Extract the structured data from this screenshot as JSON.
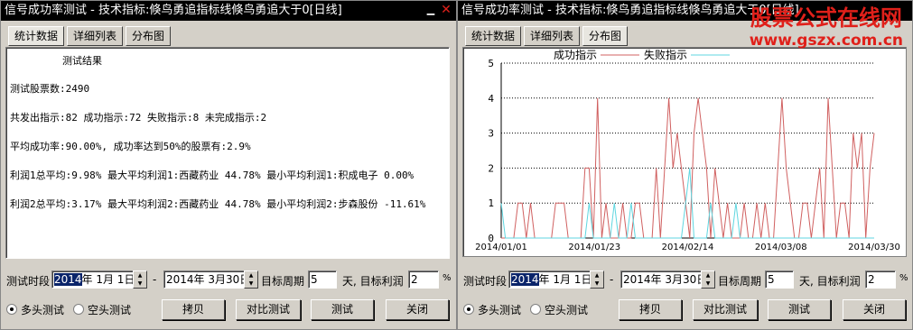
{
  "left": {
    "title": "信号成功率测试 - 技术指标:倏鸟勇追指标线倏鸟勇追大于0[日线]",
    "tabs": [
      "统计数据",
      "详细列表",
      "分布图"
    ],
    "active_tab": 0,
    "report": {
      "heading": "测试结果",
      "lines": [
        "测试股票数:2490",
        "共发出指示:82 成功指示:72 失败指示:8 未完成指示:2",
        "平均成功率:90.00%, 成功率达到50%的股票有:2.9%",
        "利润1总平均:9.98% 最大平均利润1:西藏药业 44.78% 最小平均利润1:积成电子 0.00%",
        "利润2总平均:3.17% 最大平均利润2:西藏药业 44.78% 最小平均利润2:步森股份 -11.61%"
      ]
    },
    "controls": {
      "period_label": "测试时段",
      "start_year": "2014",
      "start_rest": "年  1月 1日",
      "dash": "-",
      "end_date": "2014年  3月30日",
      "target_period_label": "目标周期",
      "target_period": "5",
      "target_profit_label": "天, 目标利润",
      "target_profit": "2",
      "percent": "%"
    },
    "radios": {
      "long": "多头测试",
      "short": "空头测试"
    },
    "buttons": {
      "copy": "拷贝",
      "compare": "对比测试",
      "test": "测试",
      "close": "关闭"
    }
  },
  "right": {
    "title": "信号成功率测试 - 技术指标:倏鸟勇追指标线倏鸟勇追大于0[日线]",
    "tabs": [
      "统计数据",
      "详细列表",
      "分布图"
    ],
    "active_tab": 2,
    "controls": {
      "period_label": "测试时段",
      "start_year": "2014",
      "start_rest": "年  1月 1日",
      "dash": "-",
      "end_date": "2014年  3月30日",
      "target_period_label": "目标周期",
      "target_period": "5",
      "target_profit_label": "天, 目标利润",
      "target_profit": "2",
      "percent": "%"
    },
    "radios": {
      "long": "多头测试",
      "short": "空头测试"
    },
    "buttons": {
      "copy": "拷贝",
      "compare": "对比测试",
      "test": "测试",
      "close": "关闭"
    }
  },
  "watermark": {
    "line1": "股票公式在线网",
    "line2": "www.gszx.com.cn"
  },
  "colors": {
    "success": "#d06060",
    "fail": "#5fd6e0",
    "grid": "#000000",
    "selection": "#0a246a"
  },
  "chart_data": {
    "type": "line",
    "ylim": [
      0,
      5
    ],
    "yticks": [
      "0",
      "1",
      "2",
      "3",
      "4",
      "5"
    ],
    "xticks": [
      "2014/01/01",
      "2014/01/23",
      "2014/02/14",
      "2014/03/08",
      "2014/03/30"
    ],
    "x_start": "2014/01/01",
    "x_end": "2014/03/30",
    "legend_position": "top",
    "series": [
      {
        "name": "成功指示",
        "points": [
          [
            0,
            0
          ],
          [
            1,
            0
          ],
          [
            3,
            0
          ],
          [
            4,
            1
          ],
          [
            5,
            1
          ],
          [
            6,
            0
          ],
          [
            7,
            1
          ],
          [
            8,
            0
          ],
          [
            12,
            0
          ],
          [
            13,
            1
          ],
          [
            14,
            1
          ],
          [
            15,
            1
          ],
          [
            16,
            0
          ],
          [
            17,
            0
          ],
          [
            18,
            0
          ],
          [
            19,
            0
          ],
          [
            20,
            2
          ],
          [
            21,
            2
          ],
          [
            22,
            0
          ],
          [
            23,
            4
          ],
          [
            24,
            0
          ],
          [
            25,
            1
          ],
          [
            26,
            0
          ],
          [
            27,
            0
          ],
          [
            28,
            0
          ],
          [
            29,
            1
          ],
          [
            30,
            0
          ],
          [
            31,
            0
          ],
          [
            32,
            1
          ],
          [
            33,
            1
          ],
          [
            34,
            0
          ],
          [
            35,
            0
          ],
          [
            36,
            0
          ],
          [
            37,
            2
          ],
          [
            38,
            0
          ],
          [
            39,
            2
          ],
          [
            40,
            4
          ],
          [
            41,
            2
          ],
          [
            42,
            3
          ],
          [
            43,
            2
          ],
          [
            44,
            1
          ],
          [
            45,
            0
          ],
          [
            46,
            3
          ],
          [
            47,
            4
          ],
          [
            48,
            3
          ],
          [
            49,
            2
          ],
          [
            50,
            0
          ],
          [
            51,
            2
          ],
          [
            52,
            1
          ],
          [
            53,
            0
          ],
          [
            54,
            1
          ],
          [
            55,
            0
          ],
          [
            56,
            0
          ],
          [
            57,
            0
          ],
          [
            58,
            1
          ],
          [
            59,
            0
          ],
          [
            60,
            0
          ],
          [
            61,
            1
          ],
          [
            62,
            0
          ],
          [
            63,
            1
          ],
          [
            64,
            0
          ],
          [
            65,
            0
          ],
          [
            66,
            2
          ],
          [
            67,
            4
          ],
          [
            68,
            2
          ],
          [
            69,
            1
          ],
          [
            70,
            0
          ],
          [
            71,
            0
          ],
          [
            72,
            1
          ],
          [
            73,
            1
          ],
          [
            74,
            0
          ],
          [
            75,
            1
          ],
          [
            76,
            2
          ],
          [
            77,
            0
          ],
          [
            78,
            4
          ],
          [
            79,
            2
          ],
          [
            80,
            0
          ],
          [
            81,
            1
          ],
          [
            82,
            1
          ],
          [
            83,
            0
          ],
          [
            84,
            3
          ],
          [
            85,
            2
          ],
          [
            86,
            3
          ],
          [
            87,
            0
          ],
          [
            88,
            2
          ],
          [
            89,
            3
          ]
        ]
      },
      {
        "name": "失败指示",
        "points": [
          [
            0,
            1
          ],
          [
            1,
            0
          ],
          [
            2,
            0
          ],
          [
            20,
            0
          ],
          [
            21,
            1
          ],
          [
            22,
            0
          ],
          [
            26,
            0
          ],
          [
            27,
            1
          ],
          [
            28,
            0
          ],
          [
            30,
            0
          ],
          [
            31,
            1
          ],
          [
            32,
            0
          ],
          [
            42,
            0
          ],
          [
            43,
            0
          ],
          [
            44,
            1
          ],
          [
            45,
            2
          ],
          [
            46,
            0
          ],
          [
            49,
            0
          ],
          [
            50,
            1
          ],
          [
            51,
            0
          ],
          [
            55,
            0
          ],
          [
            56,
            1
          ],
          [
            57,
            0
          ],
          [
            89,
            0
          ]
        ]
      }
    ]
  }
}
